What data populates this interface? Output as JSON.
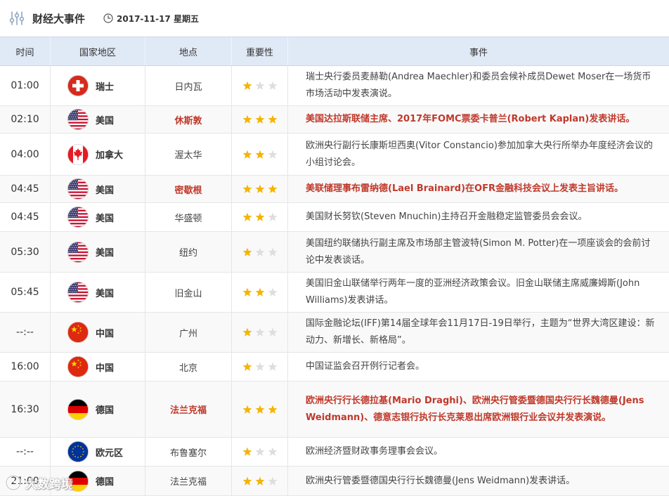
{
  "header": {
    "title_icon": "sliders-icon",
    "title": "财经大事件",
    "date_icon": "clock-icon",
    "date": "2017-11-17 星期五"
  },
  "colors": {
    "highlight": "#c0392b",
    "star_filled": "#f5b400",
    "star_empty": "#dedede",
    "header_bg": "#e0e9f6"
  },
  "table": {
    "columns": [
      "时间",
      "国家地区",
      "地点",
      "重要性",
      "事件"
    ],
    "rows": [
      {
        "time": "01:00",
        "flag": "switzerland-flag",
        "country": "瑞士",
        "location": "日内瓦",
        "importance": 1,
        "highlighted": false,
        "event": "瑞士央行委员麦赫勒(Andrea Maechler)和委员会候补成员Dewet Moser在一场货币市场活动中发表演说。"
      },
      {
        "time": "02:10",
        "flag": "usa-flag",
        "country": "美国",
        "location": "休斯敦",
        "importance": 3,
        "highlighted": true,
        "event": "美国达拉斯联储主席、2017年FOMC票委卡普兰(Robert Kaplan)发表讲话。"
      },
      {
        "time": "04:00",
        "flag": "canada-flag",
        "country": "加拿大",
        "location": "渥太华",
        "importance": 2,
        "highlighted": false,
        "event": "欧洲央行副行长康斯坦西奥(Vitor Constancio)参加加拿大央行所举办年度经济会议的小组讨论会。"
      },
      {
        "time": "04:45",
        "flag": "usa-flag",
        "country": "美国",
        "location": "密歇根",
        "importance": 3,
        "highlighted": true,
        "event": "美联储理事布雷纳德(Lael Brainard)在OFR金融科技会议上发表主旨讲话。"
      },
      {
        "time": "04:45",
        "flag": "usa-flag",
        "country": "美国",
        "location": "华盛顿",
        "importance": 2,
        "highlighted": false,
        "event": "美国财长努钦(Steven Mnuchin)主持召开金融稳定监管委员会会议。"
      },
      {
        "time": "05:30",
        "flag": "usa-flag",
        "country": "美国",
        "location": "纽约",
        "importance": 1,
        "highlighted": false,
        "event": "美国纽约联储执行副主席及市场部主管波特(Simon M. Potter)在一项座谈会的会前讨论中发表谈话。"
      },
      {
        "time": "05:45",
        "flag": "usa-flag",
        "country": "美国",
        "location": "旧金山",
        "importance": 2,
        "highlighted": false,
        "event": "美国旧金山联储举行两年一度的亚洲经济政策会议。旧金山联储主席威廉姆斯(John Williams)发表讲话。"
      },
      {
        "time": "--:--",
        "flag": "china-flag",
        "country": "中国",
        "location": "广州",
        "importance": 1,
        "highlighted": false,
        "event": "国际金融论坛(IFF)第14届全球年会11月17日-19日举行，主题为“世界大湾区建设：新动力、新增长、新格局”。"
      },
      {
        "time": "16:00",
        "flag": "china-flag",
        "country": "中国",
        "location": "北京",
        "importance": 1,
        "highlighted": false,
        "event": "中国证监会召开例行记者会。"
      },
      {
        "time": "16:30",
        "flag": "germany-flag",
        "country": "德国",
        "location": "法兰克福",
        "importance": 3,
        "highlighted": true,
        "event": "欧洲央行行长德拉基(Mario Draghi)、欧洲央行管委暨德国央行行长魏德曼(Jens Weidmann)、德意志银行执行长克莱恩出席欧洲银行业会议并发表演说。"
      },
      {
        "time": "--:--",
        "flag": "eu-flag",
        "country": "欧元区",
        "location": "布鲁塞尔",
        "importance": 1,
        "highlighted": false,
        "event": "欧洲经济暨财政事务理事会会议。"
      },
      {
        "time": "21:00",
        "flag": "germany-flag",
        "country": "德国",
        "location": "法兰克福",
        "importance": 2,
        "highlighted": false,
        "event": "欧洲央行管委暨德国央行行长魏德曼(Jens Weidmann)发表讲话。"
      }
    ]
  },
  "watermark": "大数跨境"
}
